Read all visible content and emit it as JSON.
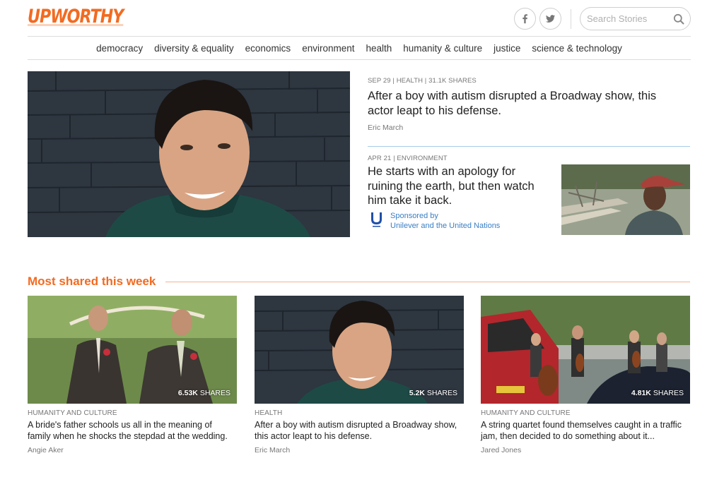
{
  "header": {
    "logo": "UPWORTHY",
    "search_placeholder": "Search Stories",
    "social": [
      "facebook-icon",
      "twitter-icon"
    ]
  },
  "nav": {
    "items": [
      "democracy",
      "diversity & equality",
      "economics",
      "environment",
      "health",
      "humanity & culture",
      "justice",
      "science & technology"
    ]
  },
  "featured": {
    "main": {
      "meta": "SEP 29 | HEALTH | 31.1K SHARES",
      "title": "After a boy with autism disrupted a Broadway show, this actor leapt to his defense.",
      "author": "Eric March"
    },
    "sponsored": {
      "meta": "APR 21 | ENVIRONMENT",
      "title": "He starts with an apology for ruining the earth, but then watch him take it back.",
      "sponsored_by": "Sponsored by",
      "sponsor_name": "Unilever and the United Nations"
    }
  },
  "most_shared": {
    "heading": "Most shared this week",
    "shares_suffix": "SHARES",
    "cards": [
      {
        "category": "HUMANITY AND CULTURE",
        "title": "A bride's father schools us all in the meaning of family when he shocks the stepdad at the wedding.",
        "author": "Angie Aker",
        "shares": "6.53K"
      },
      {
        "category": "HEALTH",
        "title": "After a boy with autism disrupted a Broadway show, this actor leapt to his defense.",
        "author": "Eric March",
        "shares": "5.2K"
      },
      {
        "category": "HUMANITY AND CULTURE",
        "title": "A string quartet found themselves caught in a traffic jam, then decided to do something about it...",
        "author": "Jared Jones",
        "shares": "4.81K"
      }
    ]
  },
  "colors": {
    "brand": "#f26b21",
    "link": "#3a7fc4",
    "divider": "#a8cbe6"
  }
}
